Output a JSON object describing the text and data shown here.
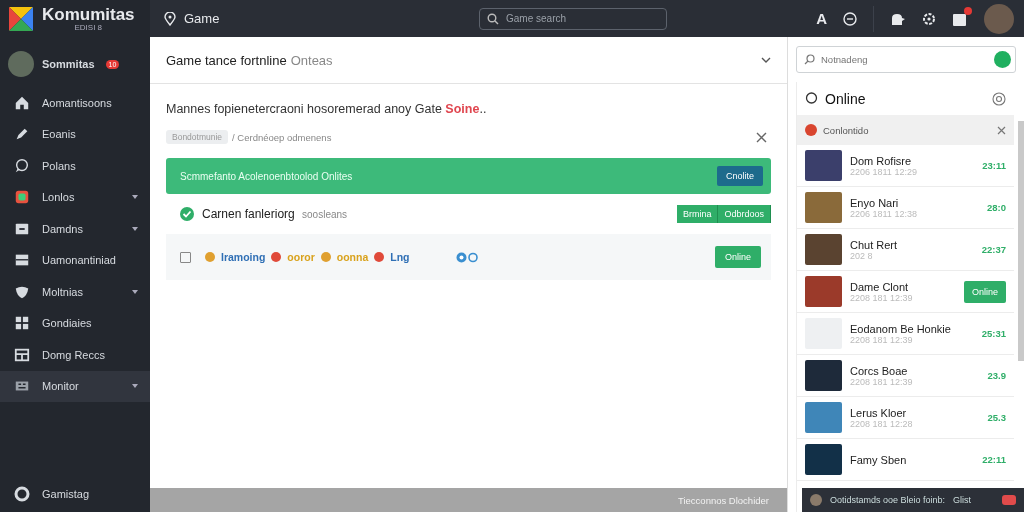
{
  "topbar": {
    "brand": "Komumitas",
    "brand_sub": "EDISI 8",
    "location": "Game",
    "search_placeholder": "Game search",
    "letter_icon": "A",
    "notification_badge": true
  },
  "sidebar": {
    "user": {
      "name": "Sommitas",
      "badge": "10"
    },
    "items": [
      {
        "label": "Aomantisoons",
        "has_submenu": false,
        "selected": false
      },
      {
        "label": "Eoanis",
        "has_submenu": false,
        "selected": false
      },
      {
        "label": "Polans",
        "has_submenu": false,
        "selected": false
      },
      {
        "label": "Lonlos",
        "has_submenu": true,
        "selected": false
      },
      {
        "label": "Damdns",
        "has_submenu": true,
        "selected": false
      },
      {
        "label": "Uamonantiniad",
        "has_submenu": false,
        "selected": false
      },
      {
        "label": "Moltnias",
        "has_submenu": true,
        "selected": false
      },
      {
        "label": "Gondiaies",
        "has_submenu": false,
        "selected": false
      },
      {
        "label": "Domg Reccs",
        "has_submenu": false,
        "selected": false
      },
      {
        "label": "Monitor",
        "has_submenu": true,
        "selected": true
      }
    ],
    "footer": "Gamistag"
  },
  "main": {
    "title": "Game tance fortnline",
    "title_note": "Onteas",
    "heading": {
      "text": "Mannes fopienetercraoni hosoremerad anoy Gate",
      "highlight": "Soine",
      "suffix": ".."
    },
    "breadcrumb": {
      "tag": "Bondotmunie",
      "path": "/ Cerdnéoep odmenens"
    },
    "banner": {
      "text": "Scmmefanto Acolenoenbtoolod Onlites",
      "button": "Cnolite"
    },
    "check_row": {
      "text": "Carnen fanleriorg",
      "note": "soosleans",
      "buttons": [
        "Brmina",
        "Odbrdoos"
      ]
    },
    "item_row": {
      "checked": false,
      "chips": [
        {
          "text": "Iramoing",
          "color": "#2f6fb5"
        },
        {
          "text": "ooror",
          "color": "#d9a21c"
        },
        {
          "text": "oonna",
          "color": "#d9a21c"
        },
        {
          "text": "Lng",
          "color": "#2f6fb5"
        }
      ],
      "button": "Online"
    },
    "status_bar": "Tiecconnos Dlochider"
  },
  "right": {
    "search_placeholder": "Notnadeng",
    "panel_title": "Online",
    "notice": "Conlontido",
    "items": [
      {
        "name": "Dom Rofisre",
        "sub": "2206 1811 12:29",
        "kind": "time",
        "time": "23:11"
      },
      {
        "name": "Enyo Nari",
        "sub": "2206 1811 12:38",
        "kind": "time",
        "time": "28:0"
      },
      {
        "name": "Chut Rert",
        "sub": "202 8",
        "kind": "time",
        "time": "22:37"
      },
      {
        "name": "Dame Clont",
        "sub": "2208 181 12:39",
        "kind": "button",
        "button": "Online"
      },
      {
        "name": "Eodanom Be Honkie",
        "sub": "2208 181 12:39",
        "kind": "time",
        "time": "25:31"
      },
      {
        "name": "Corcs Boae",
        "sub": "2208 181 12:39",
        "kind": "time",
        "time": "23.9"
      },
      {
        "name": "Lerus Kloer",
        "sub": "2208 181 12:28",
        "kind": "time",
        "time": "25.3"
      },
      {
        "name": "Famy Sben",
        "kind": "time",
        "time": "22:11"
      }
    ],
    "toast": {
      "text": "Ootidstamds ooe Bleio foinb:",
      "action": "Glist"
    }
  }
}
